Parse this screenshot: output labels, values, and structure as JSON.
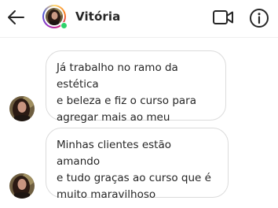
{
  "header": {
    "contact_name": "Vitória",
    "online": true
  },
  "messages": [
    {
      "text": "Já trabalho no ramo da estética\ne beleza e fiz o curso para\nagregar mais ao meu trabalho"
    },
    {
      "text": "Minhas clientes estão amando\ne tudo graças ao curso que é\nmuito maravilhoso"
    }
  ],
  "icons": {
    "back": "arrow-left-icon",
    "video": "video-camera-icon",
    "info": "info-circle-icon"
  },
  "colors": {
    "online": "#2fd26b",
    "text": "#262626",
    "bubble_border": "#dbdbdb"
  }
}
